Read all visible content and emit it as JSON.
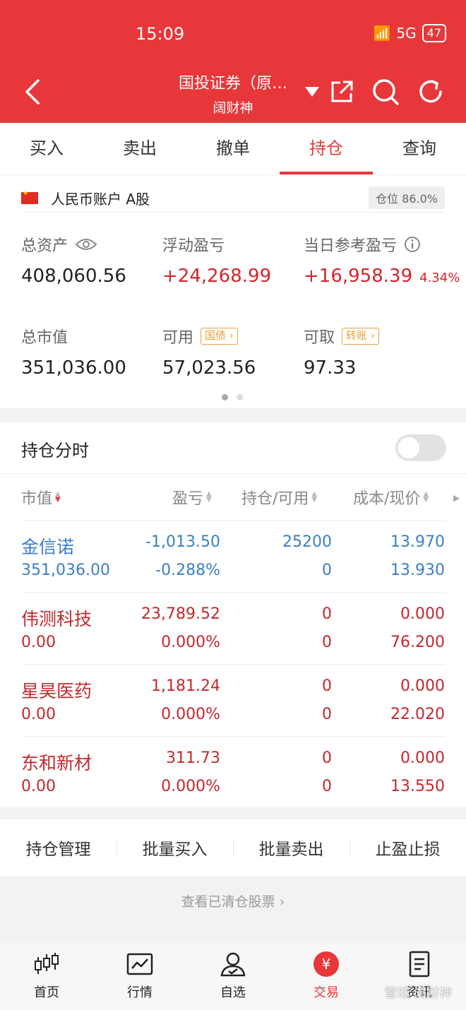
{
  "status": {
    "time": "15:09",
    "network": "5G",
    "battery": "47"
  },
  "header": {
    "title": "国投证券（原…",
    "subtitle": "阔财神"
  },
  "tabs": [
    "买入",
    "卖出",
    "撤单",
    "持仓",
    "查询"
  ],
  "account": {
    "label": "人民币账户 A股",
    "position_ratio": "仓位 86.0%",
    "total_assets_label": "总资产",
    "total_assets": "408,060.56",
    "floating_pl_label": "浮动盈亏",
    "floating_pl": "+24,268.99",
    "daily_pl_label": "当日参考盈亏",
    "daily_pl": "+16,958.39",
    "daily_pl_pct": "4.34%",
    "market_value_label": "总市值",
    "market_value": "351,036.00",
    "available_label": "可用",
    "available_tag": "国债",
    "available": "57,023.56",
    "withdrawable_label": "可取",
    "withdrawable_tag": "转账",
    "withdrawable": "97.33"
  },
  "holdings": {
    "title": "持仓分时",
    "columns": [
      "市值",
      "盈亏",
      "持仓/可用",
      "成本/现价"
    ],
    "rows": [
      {
        "name": "金信诺",
        "market_value": "351,036.00",
        "pl": "-1,013.50",
        "pl_pct": "-0.288%",
        "position": "25200",
        "available": "0",
        "cost": "13.970",
        "price": "13.930",
        "color": "blue"
      },
      {
        "name": "伟测科技",
        "market_value": "0.00",
        "pl": "23,789.52",
        "pl_pct": "0.000%",
        "position": "0",
        "available": "0",
        "cost": "0.000",
        "price": "76.200",
        "color": "red"
      },
      {
        "name": "星昊医药",
        "market_value": "0.00",
        "pl": "1,181.24",
        "pl_pct": "0.000%",
        "position": "0",
        "available": "0",
        "cost": "0.000",
        "price": "22.020",
        "color": "red"
      },
      {
        "name": "东和新材",
        "market_value": "0.00",
        "pl": "311.73",
        "pl_pct": "0.000%",
        "position": "0",
        "available": "0",
        "cost": "0.000",
        "price": "13.550",
        "color": "red"
      }
    ]
  },
  "actions": [
    "持仓管理",
    "批量买入",
    "批量卖出",
    "止盈止损"
  ],
  "cleared_link": "查看已清仓股票",
  "tabbar": [
    {
      "label": "首页",
      "icon": "candlestick-icon"
    },
    {
      "label": "行情",
      "icon": "chart-icon"
    },
    {
      "label": "自选",
      "icon": "user-check-icon"
    },
    {
      "label": "交易",
      "icon": "yen-icon"
    },
    {
      "label": "资讯",
      "icon": "document-icon"
    }
  ],
  "watermark": "雪球 阔财神",
  "colors": {
    "brand": "#e8373a",
    "up": "#c3282d",
    "down": "#3b7fc4",
    "tag": "#e6a23c"
  }
}
